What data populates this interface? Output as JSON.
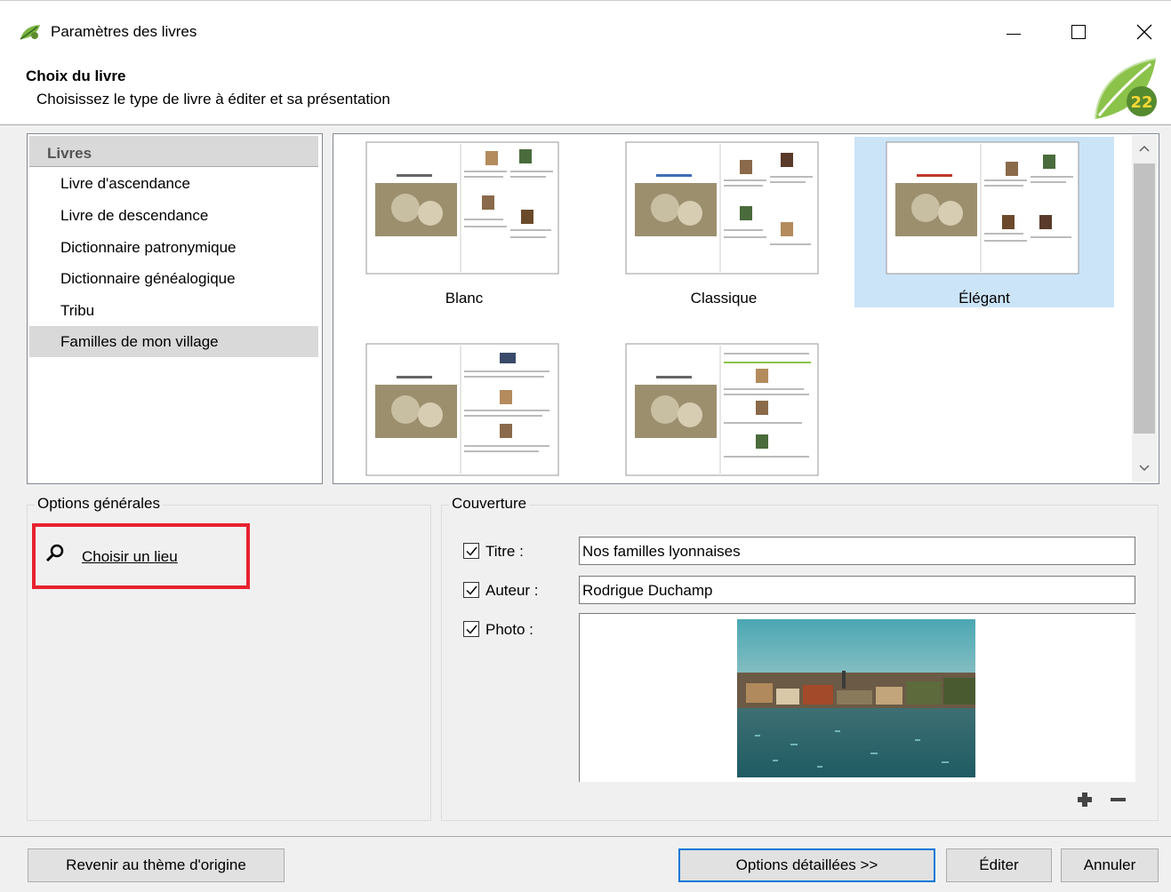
{
  "window": {
    "title": "Paramètres des livres",
    "icon": "app-leaf-icon"
  },
  "header": {
    "title": "Choix du livre",
    "subtitle": "Choisissez le type de livre à éditer et sa présentation",
    "logo": "heredis-22-logo"
  },
  "books": {
    "header": "Livres",
    "items": [
      "Livre d'ascendance",
      "Livre de descendance",
      "Dictionnaire patronymique",
      "Dictionnaire généalogique",
      "Tribu",
      "Familles de mon village"
    ],
    "selected_index": 5
  },
  "themes": [
    {
      "label": "Blanc",
      "selected": false
    },
    {
      "label": "Classique",
      "selected": false
    },
    {
      "label": "Élégant",
      "selected": true
    },
    {
      "label": "",
      "selected": false
    },
    {
      "label": "",
      "selected": false
    }
  ],
  "general_options": {
    "legend": "Options générales",
    "place_link": "Choisir un lieu",
    "place_icon": "search-icon"
  },
  "cover": {
    "legend": "Couverture",
    "title_label": "Titre :",
    "title_checked": true,
    "title_value": "Nos familles lyonnaises",
    "author_label": "Auteur :",
    "author_checked": true,
    "author_value": "Rodrigue Duchamp",
    "photo_label": "Photo :",
    "photo_checked": true,
    "add_icon": "plus-icon",
    "remove_icon": "minus-icon"
  },
  "buttons": {
    "reset": "Revenir au thème d'origine",
    "options": "Options détaillées >>",
    "edit": "Éditer",
    "cancel": "Annuler"
  },
  "colors": {
    "selection": "#cce4f7",
    "highlight_border": "#e8222f",
    "default_button_border": "#0078d7"
  }
}
